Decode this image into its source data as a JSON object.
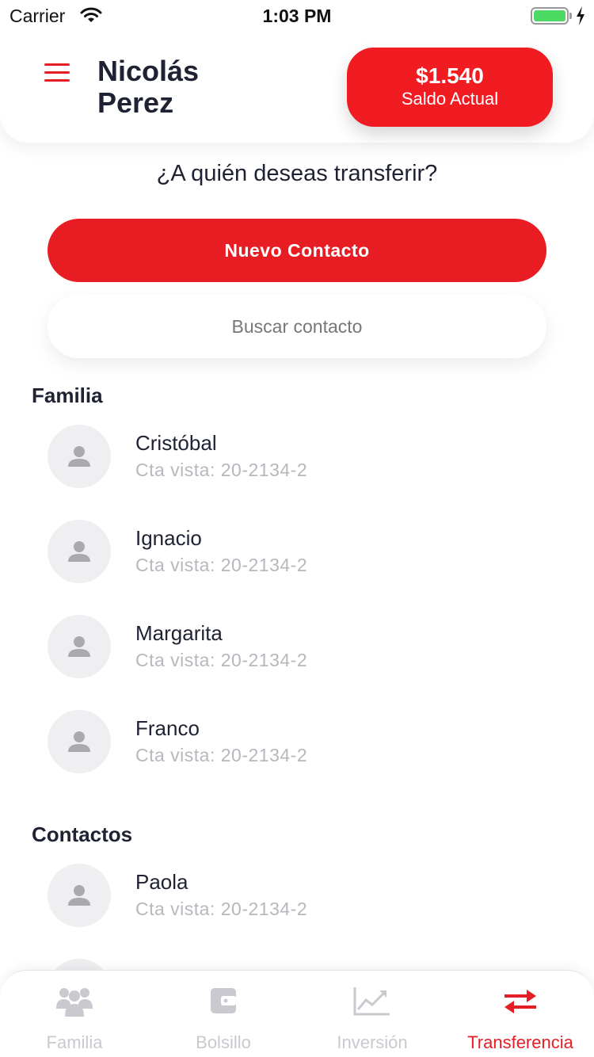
{
  "status_bar": {
    "carrier": "Carrier",
    "time": "1:03 PM"
  },
  "header": {
    "user_name": "Nicolás Perez",
    "balance_amount": "$1.540",
    "balance_label": "Saldo Actual"
  },
  "question": "¿A quién deseas transferir?",
  "new_contact_label": "Nuevo Contacto",
  "search": {
    "placeholder": "Buscar contacto",
    "value": ""
  },
  "sections": [
    {
      "title": "Familia",
      "contacts": [
        {
          "name": "Cristóbal",
          "account": "Cta vista: 20-2134-2"
        },
        {
          "name": "Ignacio",
          "account": "Cta vista: 20-2134-2"
        },
        {
          "name": "Margarita",
          "account": "Cta vista: 20-2134-2"
        },
        {
          "name": "Franco",
          "account": "Cta vista: 20-2134-2"
        }
      ]
    },
    {
      "title": "Contactos",
      "contacts": [
        {
          "name": "Paola",
          "account": "Cta vista: 20-2134-2"
        }
      ]
    }
  ],
  "tabs": [
    {
      "label": "Familia",
      "icon": "family-icon",
      "active": false
    },
    {
      "label": "Bolsillo",
      "icon": "wallet-icon",
      "active": false
    },
    {
      "label": "Inversión",
      "icon": "chart-icon",
      "active": false
    },
    {
      "label": "Transferencia",
      "icon": "transfer-icon",
      "active": true
    }
  ],
  "colors": {
    "accent": "#e31e24",
    "inactive": "#c9c9cf",
    "text": "#1f2233",
    "muted": "#b7b7be"
  }
}
